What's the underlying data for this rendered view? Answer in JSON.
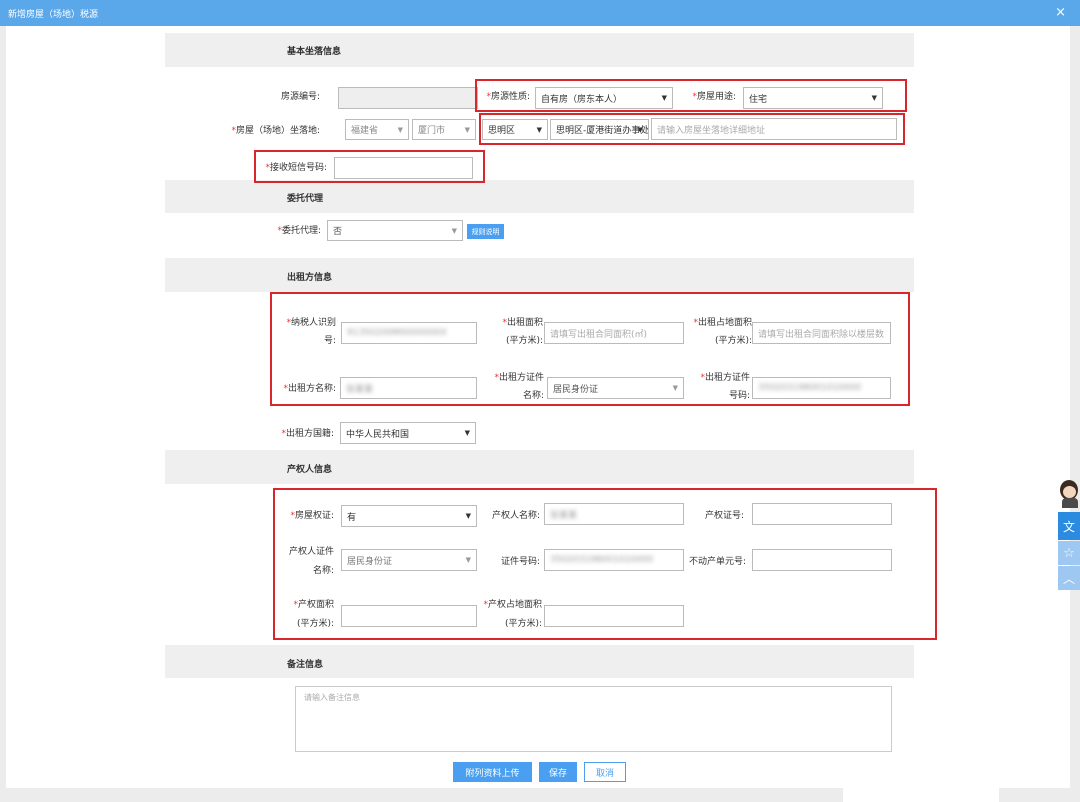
{
  "window": {
    "title": "新增房屋（场地）税源",
    "close_glyph": "×"
  },
  "sections": {
    "basic": "基本坐落信息",
    "agent": "委托代理",
    "lessor": "出租方信息",
    "owner": "产权人信息",
    "remark": "备注信息"
  },
  "basic": {
    "house_no_label": "房源编号:",
    "nature_label": "房源性质:",
    "nature_value": "自有房（房东本人）",
    "usage_label": "房屋用途:",
    "usage_value": "住宅",
    "location_label": "房屋（场地）坐落地:",
    "province": "福建省",
    "city": "厦门市",
    "district": "思明区",
    "street": "思明区-厦港街道办事处",
    "address_placeholder": "请输入房屋坐落地详细地址",
    "sms_label": "接收短信号码:"
  },
  "agent": {
    "label": "委托代理:",
    "value": "否",
    "rules_button": "规则说明"
  },
  "lessor": {
    "taxpayer_label_1": "纳税人识别",
    "taxpayer_label_2": "号:",
    "taxpayer_value": "91350200M0000000X",
    "area_label_1": "出租面积",
    "area_label_2": "(平方米):",
    "area_placeholder": "请填写出租合同面积(㎡)",
    "land_label_1": "出租占地面积",
    "land_label_2": "(平方米):",
    "land_placeholder": "请填写出租合同面积除以楼层数",
    "name_label": "出租方名称:",
    "name_value": "张某某",
    "idtype_label_1": "出租方证件",
    "idtype_label_2": "名称:",
    "idtype_value": "居民身份证",
    "idno_label_1": "出租方证件",
    "idno_label_2": "号码:",
    "idno_value": "350203198001010000",
    "nationality_label": "出租方国籍:",
    "nationality_value": "中华人民共和国"
  },
  "owner": {
    "cert_label": "房屋权证:",
    "cert_value": "有",
    "owner_name_label": "产权人名称:",
    "owner_name_value": "张某某",
    "cert_no_label": "产权证号:",
    "idtype_label_1": "产权人证件",
    "idtype_label_2": "名称:",
    "idtype_value": "居民身份证",
    "idno_label": "证件号码:",
    "idno_value": "350203198001010000",
    "unit_label": "不动产单元号:",
    "area_label_1": "产权面积",
    "area_label_2": "(平方米):",
    "land_label_1": "产权占地面积",
    "land_label_2": "(平方米):"
  },
  "remark": {
    "placeholder": "请输入备注信息"
  },
  "buttons": {
    "upload": "附列资料上传",
    "save": "保存",
    "cancel": "取消"
  },
  "sidebar": {
    "doc_icon": "文",
    "star_icon": "☆",
    "up_icon": "︿"
  },
  "colors": {
    "titlebar": "#5aa7ea",
    "accent": "#4a9ff0",
    "highlight": "#d9252c",
    "required": "#e33333"
  }
}
